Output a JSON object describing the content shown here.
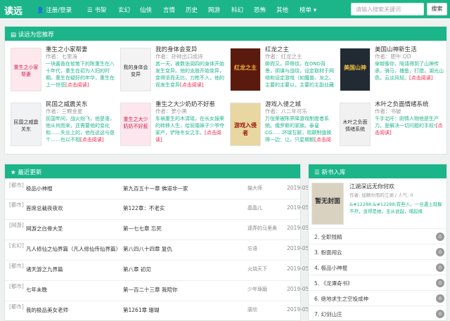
{
  "nav": {
    "logo": "读远",
    "login": "注册/登录",
    "items": [
      "书架",
      "玄幻",
      "仙侠",
      "言情",
      "历史",
      "网游",
      "科幻",
      "恐怖",
      "其他",
      "榜单"
    ],
    "search_placeholder": "请输入搜索关键词",
    "search_button": "搜索"
  },
  "recommend": {
    "title": "读远为您推荐",
    "more_label": "[点击阅读]",
    "books": [
      {
        "title": "重生之小家帮妻",
        "author": "作者：七里海",
        "desc": "一块酱香在软笔下的陈重生在八十年代，重生在初为人妇的时期。重生在疑好的年华，重生在上一世悲",
        "cover": "重生之小家帮妻"
      },
      {
        "title": "我的身体会变异",
        "author": "作者：孙钟出口成诗",
        "desc": "其一天，被数张阅四的身体开始发生变异。他的支肢开始变异，变得坚而无比，刀枪不入，他的视发生变异",
        "cover": "我的身体会变异"
      },
      {
        "title": "红龙之主",
        "author": "作者：红龙之主",
        "desc": "肿而又，异骨纹，在DND背景，阴谋与战纹，设定取材于网络和设定游戏（如魔兽、龙之、主要的主要以，主要的主副业藏法倒码",
        "cover": "红龙之主"
      },
      {
        "title": "美国山神新生活",
        "author": "作者：肥牛.QD",
        "desc": "穿越像你，陪请得到了山神传承。骑马，捕鱼，打猎，湖光山色，云淡风轻。",
        "cover": "美国山神"
      },
      {
        "title": "民国之威震关东",
        "author": "作者：三颗金星",
        "desc": "民国年间，战火纷飞，他是谁，他从何而来，还需要他的变化和……失业上的，他在这这与是个……也以不相",
        "cover": "民国之威震关东"
      },
      {
        "title": "重生之大少奶奶不好惹",
        "author": "作者：萝小黑",
        "desc": "车祸重生的木清瑶，在长女报荣的转移人生，给前婚妹子少爷夺家产，铲除冬女之手。",
        "cover": "重生之大少奶奶不好惹"
      },
      {
        "title": "游戏入侵之城",
        "author": "作者：八二年可乐",
        "desc": "万恒荣被陈界降游戏制度者系统。俄罗斯的家族。泰皇CG……环球互联，用颠制值换得一边：让，只星期额",
        "cover": "游戏入侵者"
      },
      {
        "title": "木叶之负面情绪系统",
        "author": "作者：书破",
        "desc": "千手北吁：刚情人物他是生产力，是解决一切问题的手段!",
        "cover": "木叶之负面情绪系统"
      }
    ]
  },
  "latest": {
    "title": "最近更新",
    "rows": [
      {
        "cat": "[都市]",
        "name": "极品小神棍",
        "chapter": "第九百五十一章 佛道非一家",
        "author": "猫大师",
        "date": "2019-05-14"
      },
      {
        "cat": "[都市]",
        "name": "首席总裁夜夜欢",
        "chapter": "第122章：不老实",
        "author": "晶晶儿",
        "date": "2019-05-14"
      },
      {
        "cat": "[网游]",
        "name": "网游之白骨大圣",
        "chapter": "第一七七章 忘死",
        "author": "逐弄的马里奥",
        "date": "2019-05-14"
      },
      {
        "cat": "[玄幻]",
        "name": "凡人修仙之仙界篇（凡人修仙传仙界篇）",
        "chapter": "第八四八十四章 复仇",
        "author": "忘语",
        "date": "2019-05-14"
      },
      {
        "cat": "[都市]",
        "name": "诸天游之九界篇",
        "chapter": "第八章 初见",
        "author": "火烧天下",
        "date": "2019-05-14"
      },
      {
        "cat": "[都市]",
        "name": "七年未晚",
        "chapter": "第一百二十三章 我陪你",
        "author": "少年琢磨",
        "date": "2019-05-14"
      },
      {
        "cat": "[都市]",
        "name": "我的极品美女老师",
        "chapter": "第1261章 珊瑚",
        "author": "唐欣",
        "date": "2019-05-14"
      }
    ]
  },
  "newbooks": {
    "title": "新书入库",
    "top": {
      "title": "江湖深远无你何欢",
      "meta": "作者: 加精尔而的江湖 / 人气: 0",
      "desc": "&#12288;&#12288;有些人，一旦遇上就躲不开，显得是她，无从说起，缘起缘",
      "cover": "暂无封面"
    },
    "items": [
      {
        "label": "2. 全职残精",
        "count": "0"
      },
      {
        "label": "3. 粉面闯云",
        "count": "0"
      },
      {
        "label": "4. 极品小神棍",
        "count": "0"
      },
      {
        "label": "5. 《龙潭奇书》",
        "count": "0"
      },
      {
        "label": "6. 绝地求生之空投成神",
        "count": "0"
      },
      {
        "label": "7. 幻剑山庄",
        "count": "0"
      }
    ]
  }
}
